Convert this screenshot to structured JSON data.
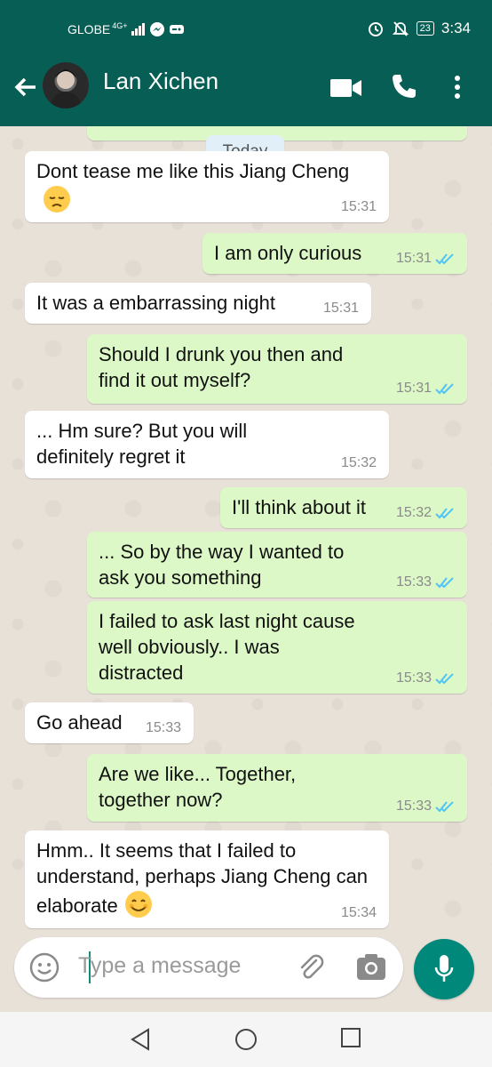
{
  "status_bar": {
    "carrier": "GLOBE",
    "network": "4G+",
    "battery": "23",
    "time": "3:34"
  },
  "header": {
    "contact_name": "Lan Xichen",
    "icons": [
      "back-arrow-icon",
      "video-call-icon",
      "phone-icon",
      "more-vert-icon"
    ]
  },
  "chat": {
    "date_chip": "Today",
    "messages": [
      {
        "dir": "in",
        "text": "Dont tease me like this Jiang Cheng",
        "emoji": "pensive",
        "time": "15:31"
      },
      {
        "dir": "out",
        "text": "I am only curious",
        "time": "15:31"
      },
      {
        "dir": "in",
        "text": "It was a embarrassing night",
        "time": "15:31"
      },
      {
        "dir": "out",
        "text": "Should I drunk you then and find it out myself?",
        "time": "15:31"
      },
      {
        "dir": "in",
        "text": "... Hm sure? But you will definitely regret it",
        "time": "15:32"
      },
      {
        "dir": "out",
        "text": "I'll think about it",
        "time": "15:32"
      },
      {
        "dir": "out",
        "text": "... So by the way I wanted to ask you something",
        "time": "15:33"
      },
      {
        "dir": "out",
        "text": "I failed to ask last night cause well obviously.. I was distracted",
        "time": "15:33"
      },
      {
        "dir": "in",
        "text": "Go ahead",
        "time": "15:33"
      },
      {
        "dir": "out",
        "text": "Are we like... Together, together now?",
        "time": "15:33"
      },
      {
        "dir": "in",
        "text": "Hmm.. It seems that I failed to understand, perhaps Jiang Cheng can elaborate",
        "emoji": "smiling",
        "time": "15:34"
      }
    ]
  },
  "composer": {
    "placeholder": "Type a message",
    "icons": [
      "emoji-icon",
      "attach-icon",
      "camera-icon",
      "mic-icon"
    ]
  },
  "colors": {
    "header": "#075e54",
    "outgoing_bubble": "#dcf8c6",
    "incoming_bubble": "#ffffff",
    "read_ticks": "#4fc3f7",
    "mic_button": "#00897b"
  }
}
